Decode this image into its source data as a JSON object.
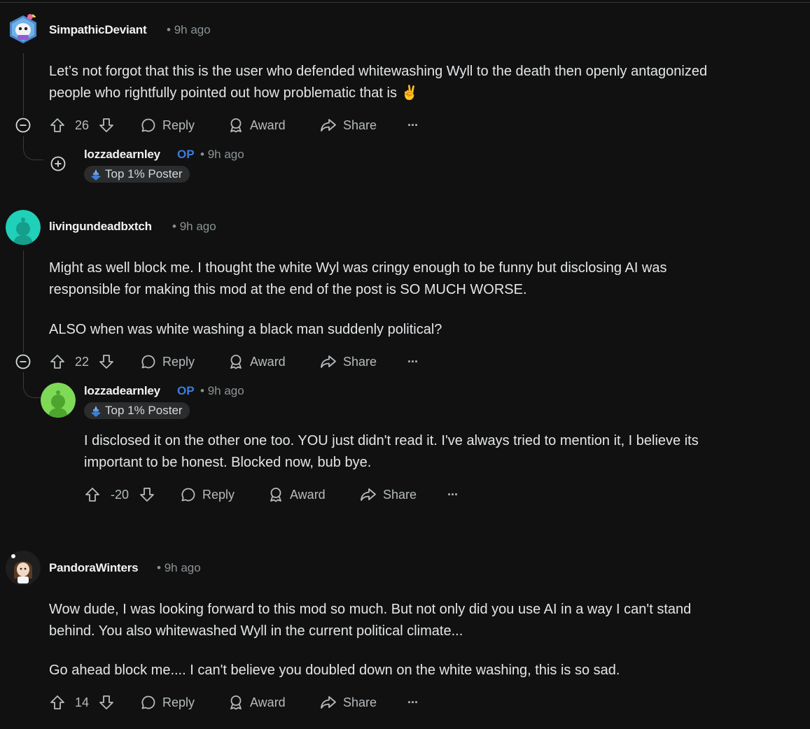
{
  "comments": [
    {
      "username": "SimpathicDeviant",
      "age": "9h ago",
      "lines": [
        "Let’s not forgot that this is the user who defended whitewashing Wyll to the death then openly antagonized",
        "people who rightfully pointed out how problematic that is ✌️"
      ],
      "votes": "26",
      "reply_label": "Reply",
      "award_label": "Award",
      "share_label": "Share",
      "more_label": "···",
      "reply": {
        "username": "lozzadearnley",
        "op_label": "OP",
        "age": "9h ago",
        "flair": "Top 1% Poster"
      }
    },
    {
      "username": "livingundeadbxtch",
      "age": "9h ago",
      "lines": [
        "Might as well block me. I thought the white Wyl was cringy enough to be funny but disclosing AI was",
        "responsible for making this mod at the end of the post is SO MUCH WORSE."
      ],
      "para2": "ALSO when was white washing a black man suddenly political?",
      "votes": "22",
      "reply_label": "Reply",
      "award_label": "Award",
      "share_label": "Share",
      "more_label": "···",
      "reply": {
        "username": "lozzadearnley",
        "op_label": "OP",
        "age": "9h ago",
        "flair": "Top 1% Poster",
        "lines": [
          "I disclosed it on the other one too. YOU just didn't read it. I've always tried to mention it, I believe its",
          "important to be honest. Blocked now, bub bye."
        ],
        "votes": "-20",
        "reply_label": "Reply",
        "award_label": "Award",
        "share_label": "Share",
        "more_label": "···"
      }
    },
    {
      "username": "PandoraWinters",
      "age": "9h ago",
      "lines": [
        "Wow dude, I was looking forward to this mod so much. But not only did you use AI in a way I can't stand",
        "behind. You also whitewashed Wyll in the current political climate..."
      ],
      "para2": "Go ahead block me.... I can't believe you doubled down on the white washing, this is so sad.",
      "votes": "14",
      "reply_label": "Reply",
      "award_label": "Award",
      "share_label": "Share",
      "more_label": "···"
    }
  ],
  "meta_separator": "•",
  "colors": {
    "background": "#111111",
    "op_blue": "#3b7de0",
    "text": "#e3e6e8",
    "muted": "#8b9296"
  }
}
